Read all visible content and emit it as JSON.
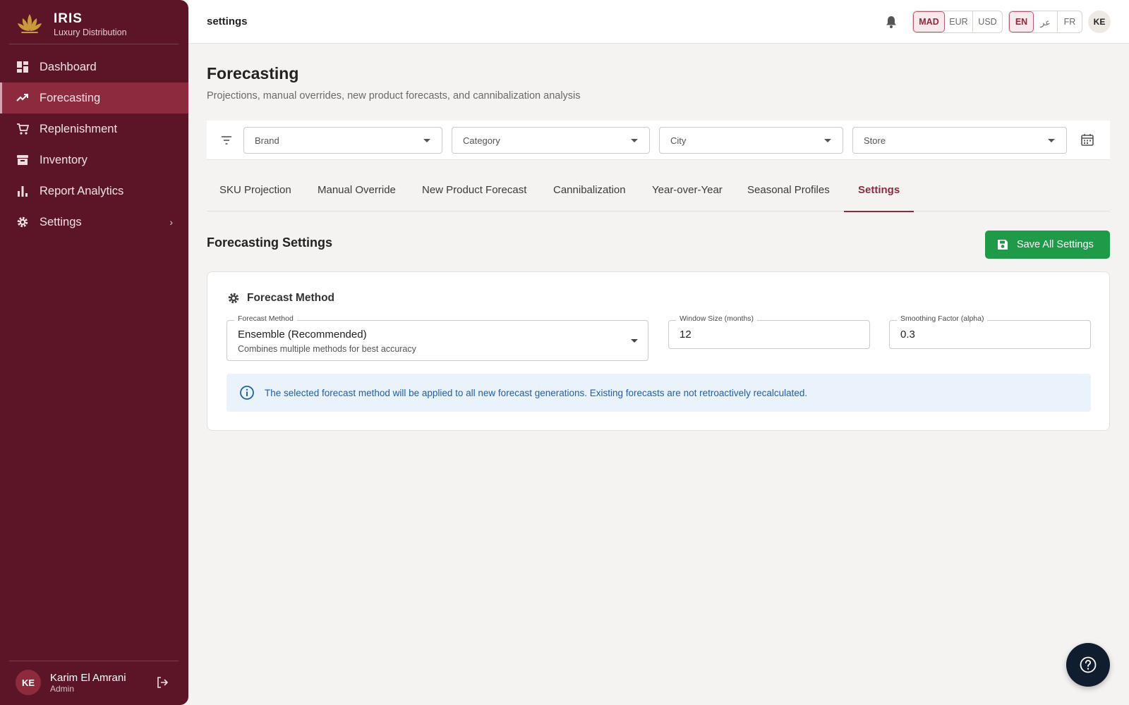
{
  "brand": {
    "title": "IRIS",
    "subtitle": "Luxury Distribution"
  },
  "sidebar": {
    "items": [
      {
        "label": "Dashboard",
        "icon": "dashboard-icon"
      },
      {
        "label": "Forecasting",
        "icon": "trending-up-icon",
        "active": true
      },
      {
        "label": "Replenishment",
        "icon": "cart-icon"
      },
      {
        "label": "Inventory",
        "icon": "archive-icon"
      },
      {
        "label": "Report Analytics",
        "icon": "bar-chart-icon"
      },
      {
        "label": "Settings",
        "icon": "gear-icon"
      }
    ],
    "user": {
      "initials": "KE",
      "name": "Karim El Amrani",
      "role": "Admin"
    }
  },
  "topbar": {
    "breadcrumb": "settings",
    "currencies": [
      "MAD",
      "EUR",
      "USD"
    ],
    "selected_currency": "MAD",
    "languages": [
      "EN",
      "عر",
      "FR"
    ],
    "selected_language": "EN",
    "avatar_initials": "KE"
  },
  "page": {
    "title": "Forecasting",
    "subtitle": "Projections, manual overrides, new product forecasts, and cannibalization analysis"
  },
  "filters": {
    "brand": "Brand",
    "category": "Category",
    "city": "City",
    "store": "Store"
  },
  "tabs": [
    {
      "label": "SKU Projection"
    },
    {
      "label": "Manual Override"
    },
    {
      "label": "New Product Forecast"
    },
    {
      "label": "Cannibalization"
    },
    {
      "label": "Year-over-Year"
    },
    {
      "label": "Seasonal Profiles"
    },
    {
      "label": "Settings",
      "active": true
    }
  ],
  "settings": {
    "section_title": "Forecasting Settings",
    "save_label": "Save All Settings",
    "card_title": "Forecast Method",
    "method": {
      "label": "Forecast Method",
      "value": "Ensemble (Recommended)",
      "description": "Combines multiple methods for best accuracy"
    },
    "window": {
      "label": "Window Size (months)",
      "value": "12"
    },
    "smoothing": {
      "label": "Smoothing Factor (alpha)",
      "value": "0.3"
    },
    "info": "The selected forecast method will be applied to all new forecast generations. Existing forecasts are not retroactively recalculated."
  },
  "colors": {
    "sidebar": "#5c1526",
    "accent": "#8e2a3e",
    "save_button": "#1e9a48",
    "info_bg": "#eaf2fb",
    "info_text": "#1f5fae"
  }
}
